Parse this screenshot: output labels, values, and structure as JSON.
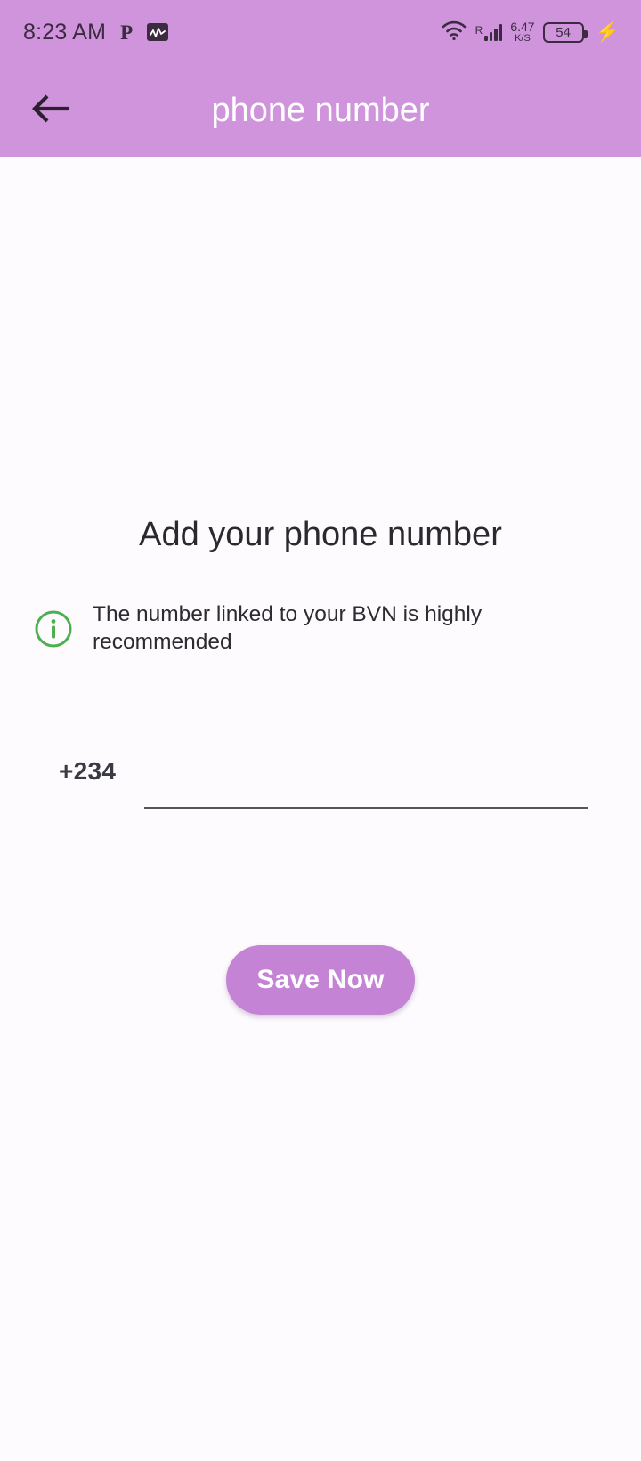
{
  "status_bar": {
    "time": "8:23 AM",
    "app_icon_p": "P",
    "app_icon_graph": "graph-icon",
    "wifi_icon": "wifi-icon",
    "roaming_label": "R",
    "signal_icon": "signal-bars-icon",
    "network_speed_value": "6.47",
    "network_speed_unit": "K/S",
    "battery_level": "54",
    "charging_icon": "⚡"
  },
  "app_bar": {
    "back_icon": "back-arrow-icon",
    "title": "phone number",
    "background_color": "#d094dc",
    "title_color": "#ffffff"
  },
  "main": {
    "heading": "Add your phone number",
    "info": {
      "icon": "info-circle-icon",
      "icon_color": "#4CAF50",
      "text": "The number linked to your BVN is highly recommended"
    },
    "phone_input": {
      "country_code": "+234",
      "value": "",
      "placeholder": ""
    },
    "save_button": {
      "label": "Save Now",
      "background_color": "#c483d4",
      "text_color": "#ffffff"
    }
  }
}
